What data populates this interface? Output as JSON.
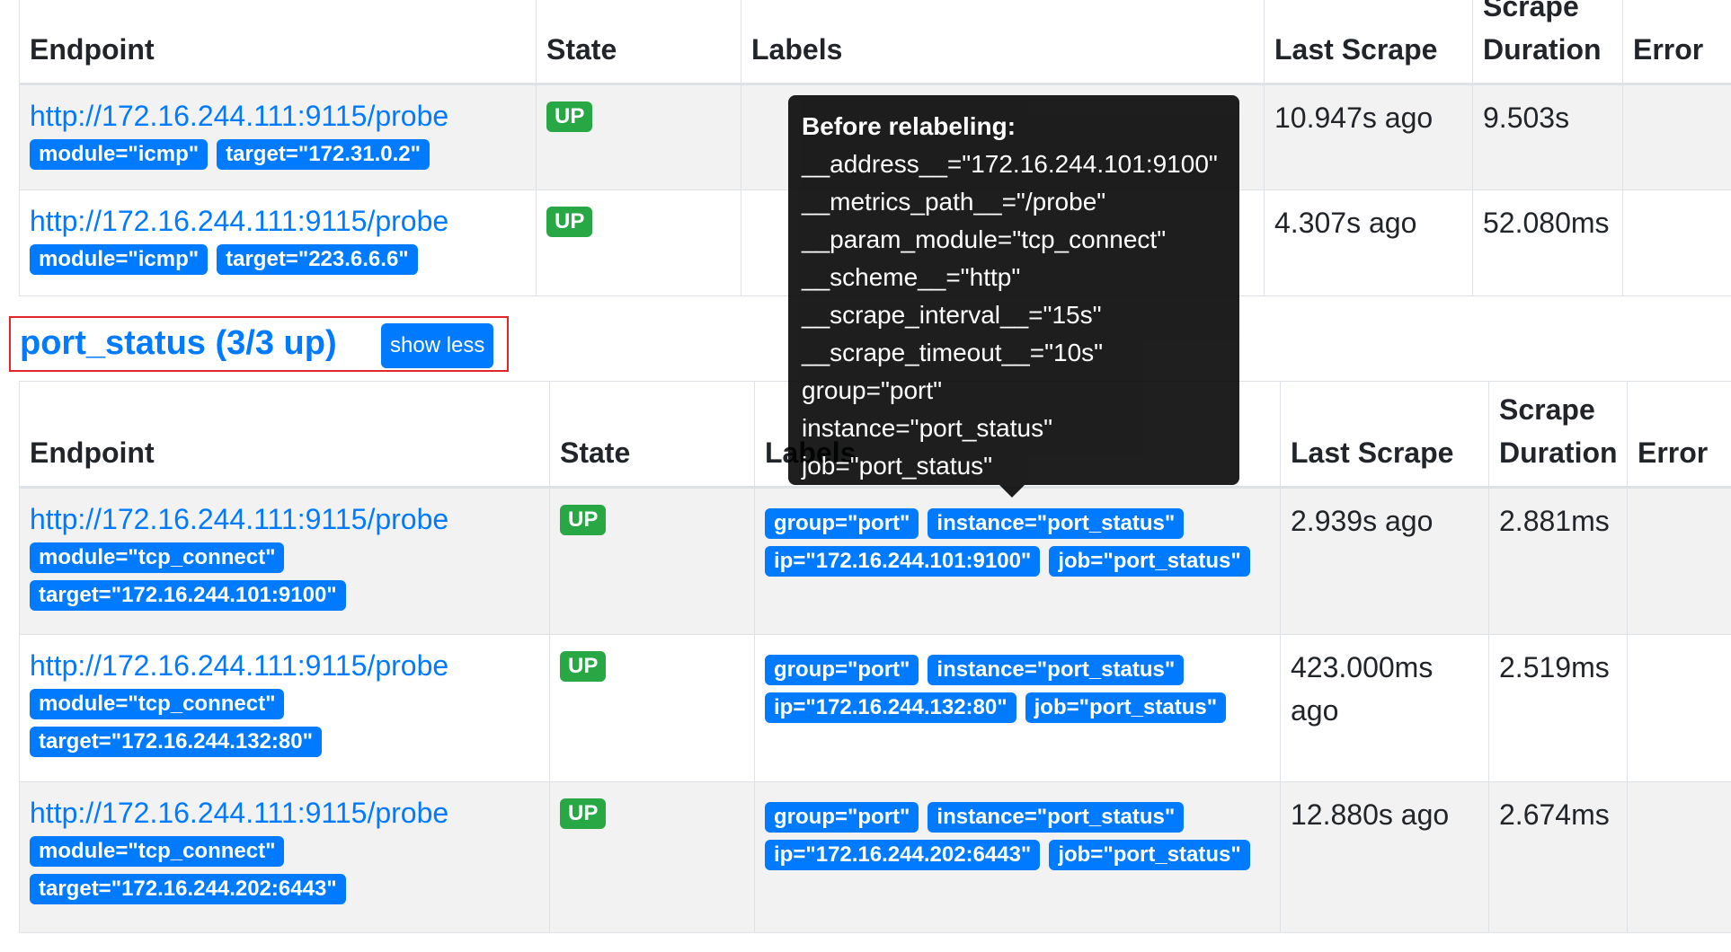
{
  "headers": {
    "endpoint": "Endpoint",
    "state": "State",
    "labels": "Labels",
    "last_scrape": "Last Scrape",
    "scrape_duration_line1": "Scrape",
    "scrape_duration_line2": "Duration",
    "error": "Error"
  },
  "top_rows": [
    {
      "endpoint": "http://172.16.244.111:9115/probe",
      "endpoint_labels": [
        "module=\"icmp\"",
        "target=\"172.31.0.2\""
      ],
      "state": "UP",
      "last_scrape": "10.947s ago",
      "duration": "9.503s",
      "error": ""
    },
    {
      "endpoint": "http://172.16.244.111:9115/probe",
      "endpoint_labels": [
        "module=\"icmp\"",
        "target=\"223.6.6.6\""
      ],
      "state": "UP",
      "last_scrape": "4.307s ago",
      "duration": "52.080ms",
      "error": ""
    }
  ],
  "section": {
    "title": "port_status (3/3 up)",
    "toggle_label": "show less"
  },
  "port_rows": [
    {
      "endpoint": "http://172.16.244.111:9115/probe",
      "endpoint_labels": [
        "module=\"tcp_connect\"",
        "target=\"172.16.244.101:9100\""
      ],
      "state": "UP",
      "labels": [
        "group=\"port\"",
        "instance=\"port_status\"",
        "ip=\"172.16.244.101:9100\"",
        "job=\"port_status\""
      ],
      "last_scrape": "2.939s ago",
      "duration": "2.881ms",
      "error": ""
    },
    {
      "endpoint": "http://172.16.244.111:9115/probe",
      "endpoint_labels": [
        "module=\"tcp_connect\"",
        "target=\"172.16.244.132:80\""
      ],
      "state": "UP",
      "labels": [
        "group=\"port\"",
        "instance=\"port_status\"",
        "ip=\"172.16.244.132:80\"",
        "job=\"port_status\""
      ],
      "last_scrape": "423.000ms ago",
      "duration": "2.519ms",
      "error": ""
    },
    {
      "endpoint": "http://172.16.244.111:9115/probe",
      "endpoint_labels": [
        "module=\"tcp_connect\"",
        "target=\"172.16.244.202:6443\""
      ],
      "state": "UP",
      "labels": [
        "group=\"port\"",
        "instance=\"port_status\"",
        "ip=\"172.16.244.202:6443\"",
        "job=\"port_status\""
      ],
      "last_scrape": "12.880s ago",
      "duration": "2.674ms",
      "error": ""
    }
  ],
  "tooltip": {
    "title": "Before relabeling:",
    "lines": [
      "__address__=\"172.16.244.101:9100\"",
      "__metrics_path__=\"/probe\"",
      "__param_module=\"tcp_connect\"",
      "__scheme__=\"http\"",
      "__scrape_interval__=\"15s\"",
      "__scrape_timeout__=\"10s\"",
      "group=\"port\"",
      "instance=\"port_status\"",
      "job=\"port_status\""
    ]
  },
  "colors": {
    "link": "#007bff",
    "badge_primary": "#007bff",
    "badge_up": "#28a745",
    "highlight_border": "#e0262b",
    "tooltip_bg": "#000000"
  }
}
